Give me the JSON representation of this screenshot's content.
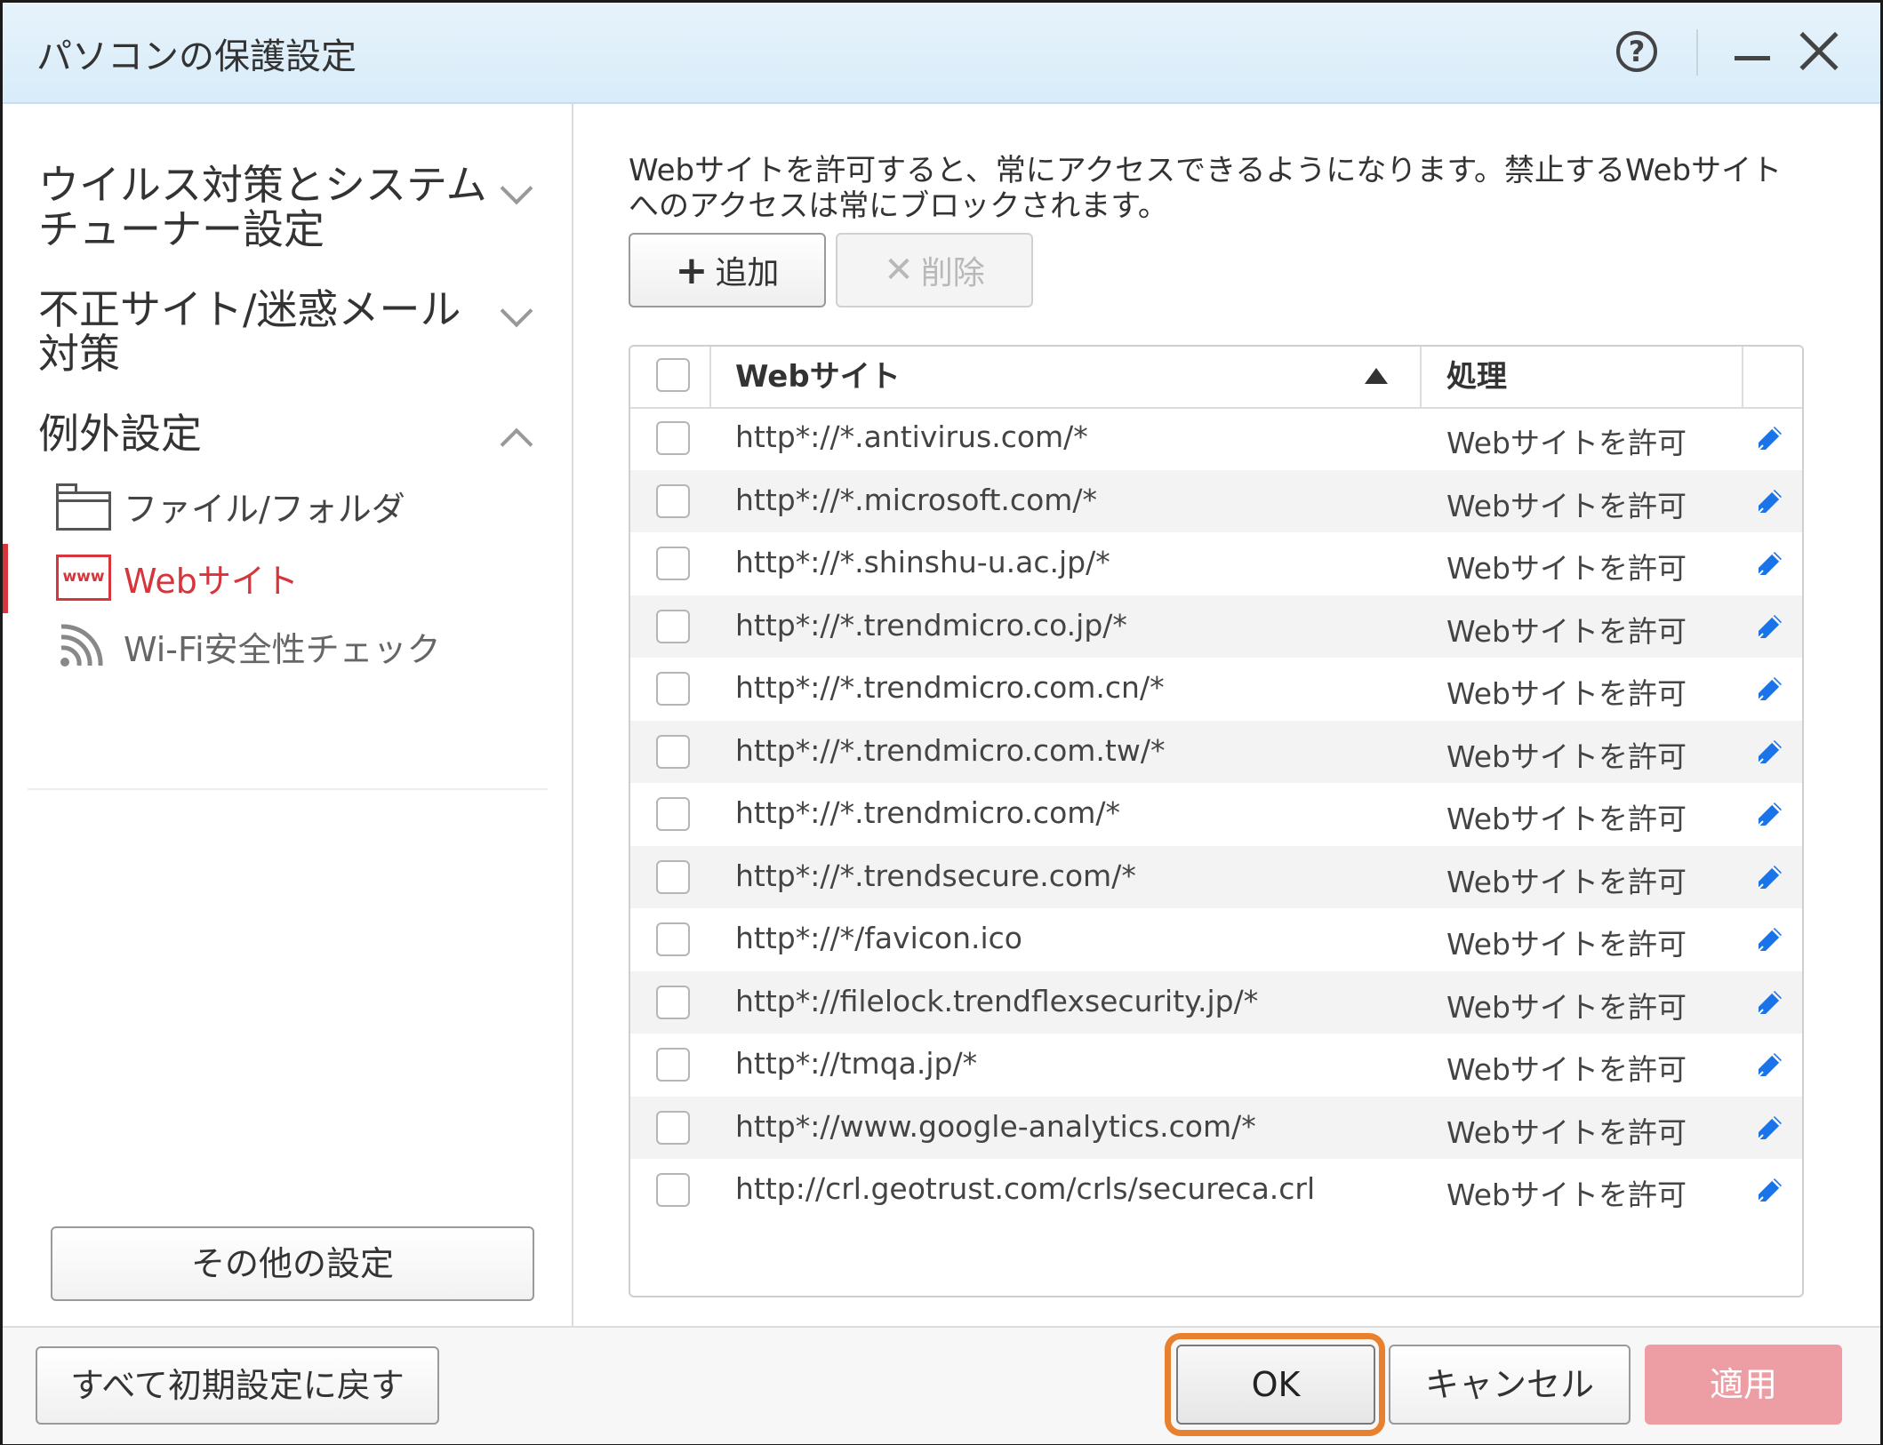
{
  "window": {
    "title": "パソコンの保護設定",
    "help_symbol": "?"
  },
  "sidebar": {
    "sections": [
      {
        "label_line1": "ウイルス対策とシステム",
        "label_line2": "チューナー設定",
        "expanded": false
      },
      {
        "label_line1": "不正サイト/迷惑メール",
        "label_line2": "対策",
        "expanded": false
      },
      {
        "label_line1": "例外設定",
        "label_line2": "",
        "expanded": true
      }
    ],
    "sub_items": [
      {
        "label": "ファイル/フォルダ",
        "icon": "folder-icon",
        "active": false
      },
      {
        "label": "Webサイト",
        "icon": "www-icon",
        "icon_text": "www",
        "active": true
      },
      {
        "label": "Wi-Fi安全性チェック",
        "icon": "wifi-icon",
        "active": false
      }
    ],
    "other_settings_label": "その他の設定"
  },
  "main": {
    "description": "Webサイトを許可すると、常にアクセスできるようになります。禁止するWebサイトへのアクセスは常にブロックされます。",
    "add_label": "追加",
    "delete_label": "削除",
    "table": {
      "col_website": "Webサイト",
      "col_action": "処理",
      "rows": [
        {
          "url": "http*://*.antivirus.com/*",
          "action": "Webサイトを許可"
        },
        {
          "url": "http*://*.microsoft.com/*",
          "action": "Webサイトを許可"
        },
        {
          "url": "http*://*.shinshu-u.ac.jp/*",
          "action": "Webサイトを許可"
        },
        {
          "url": "http*://*.trendmicro.co.jp/*",
          "action": "Webサイトを許可"
        },
        {
          "url": "http*://*.trendmicro.com.cn/*",
          "action": "Webサイトを許可"
        },
        {
          "url": "http*://*.trendmicro.com.tw/*",
          "action": "Webサイトを許可"
        },
        {
          "url": "http*://*.trendmicro.com/*",
          "action": "Webサイトを許可"
        },
        {
          "url": "http*://*.trendsecure.com/*",
          "action": "Webサイトを許可"
        },
        {
          "url": "http*://*/favicon.ico",
          "action": "Webサイトを許可"
        },
        {
          "url": "http*://filelock.trendflexsecurity.jp/*",
          "action": "Webサイトを許可"
        },
        {
          "url": "http*://tmqa.jp/*",
          "action": "Webサイトを許可"
        },
        {
          "url": "http*://www.google-analytics.com/*",
          "action": "Webサイトを許可"
        },
        {
          "url": "http://crl.geotrust.com/crls/secureca.crl",
          "action": "Webサイトを許可"
        }
      ]
    }
  },
  "footer": {
    "reset_label": "すべて初期設定に戻す",
    "ok_label": "OK",
    "cancel_label": "キャンセル",
    "apply_label": "適用"
  },
  "colors": {
    "accent_red": "#d6353c",
    "highlight_orange": "#e9802e",
    "pencil_blue": "#1a73e8",
    "apply_disabled": "#ec9ea4"
  }
}
